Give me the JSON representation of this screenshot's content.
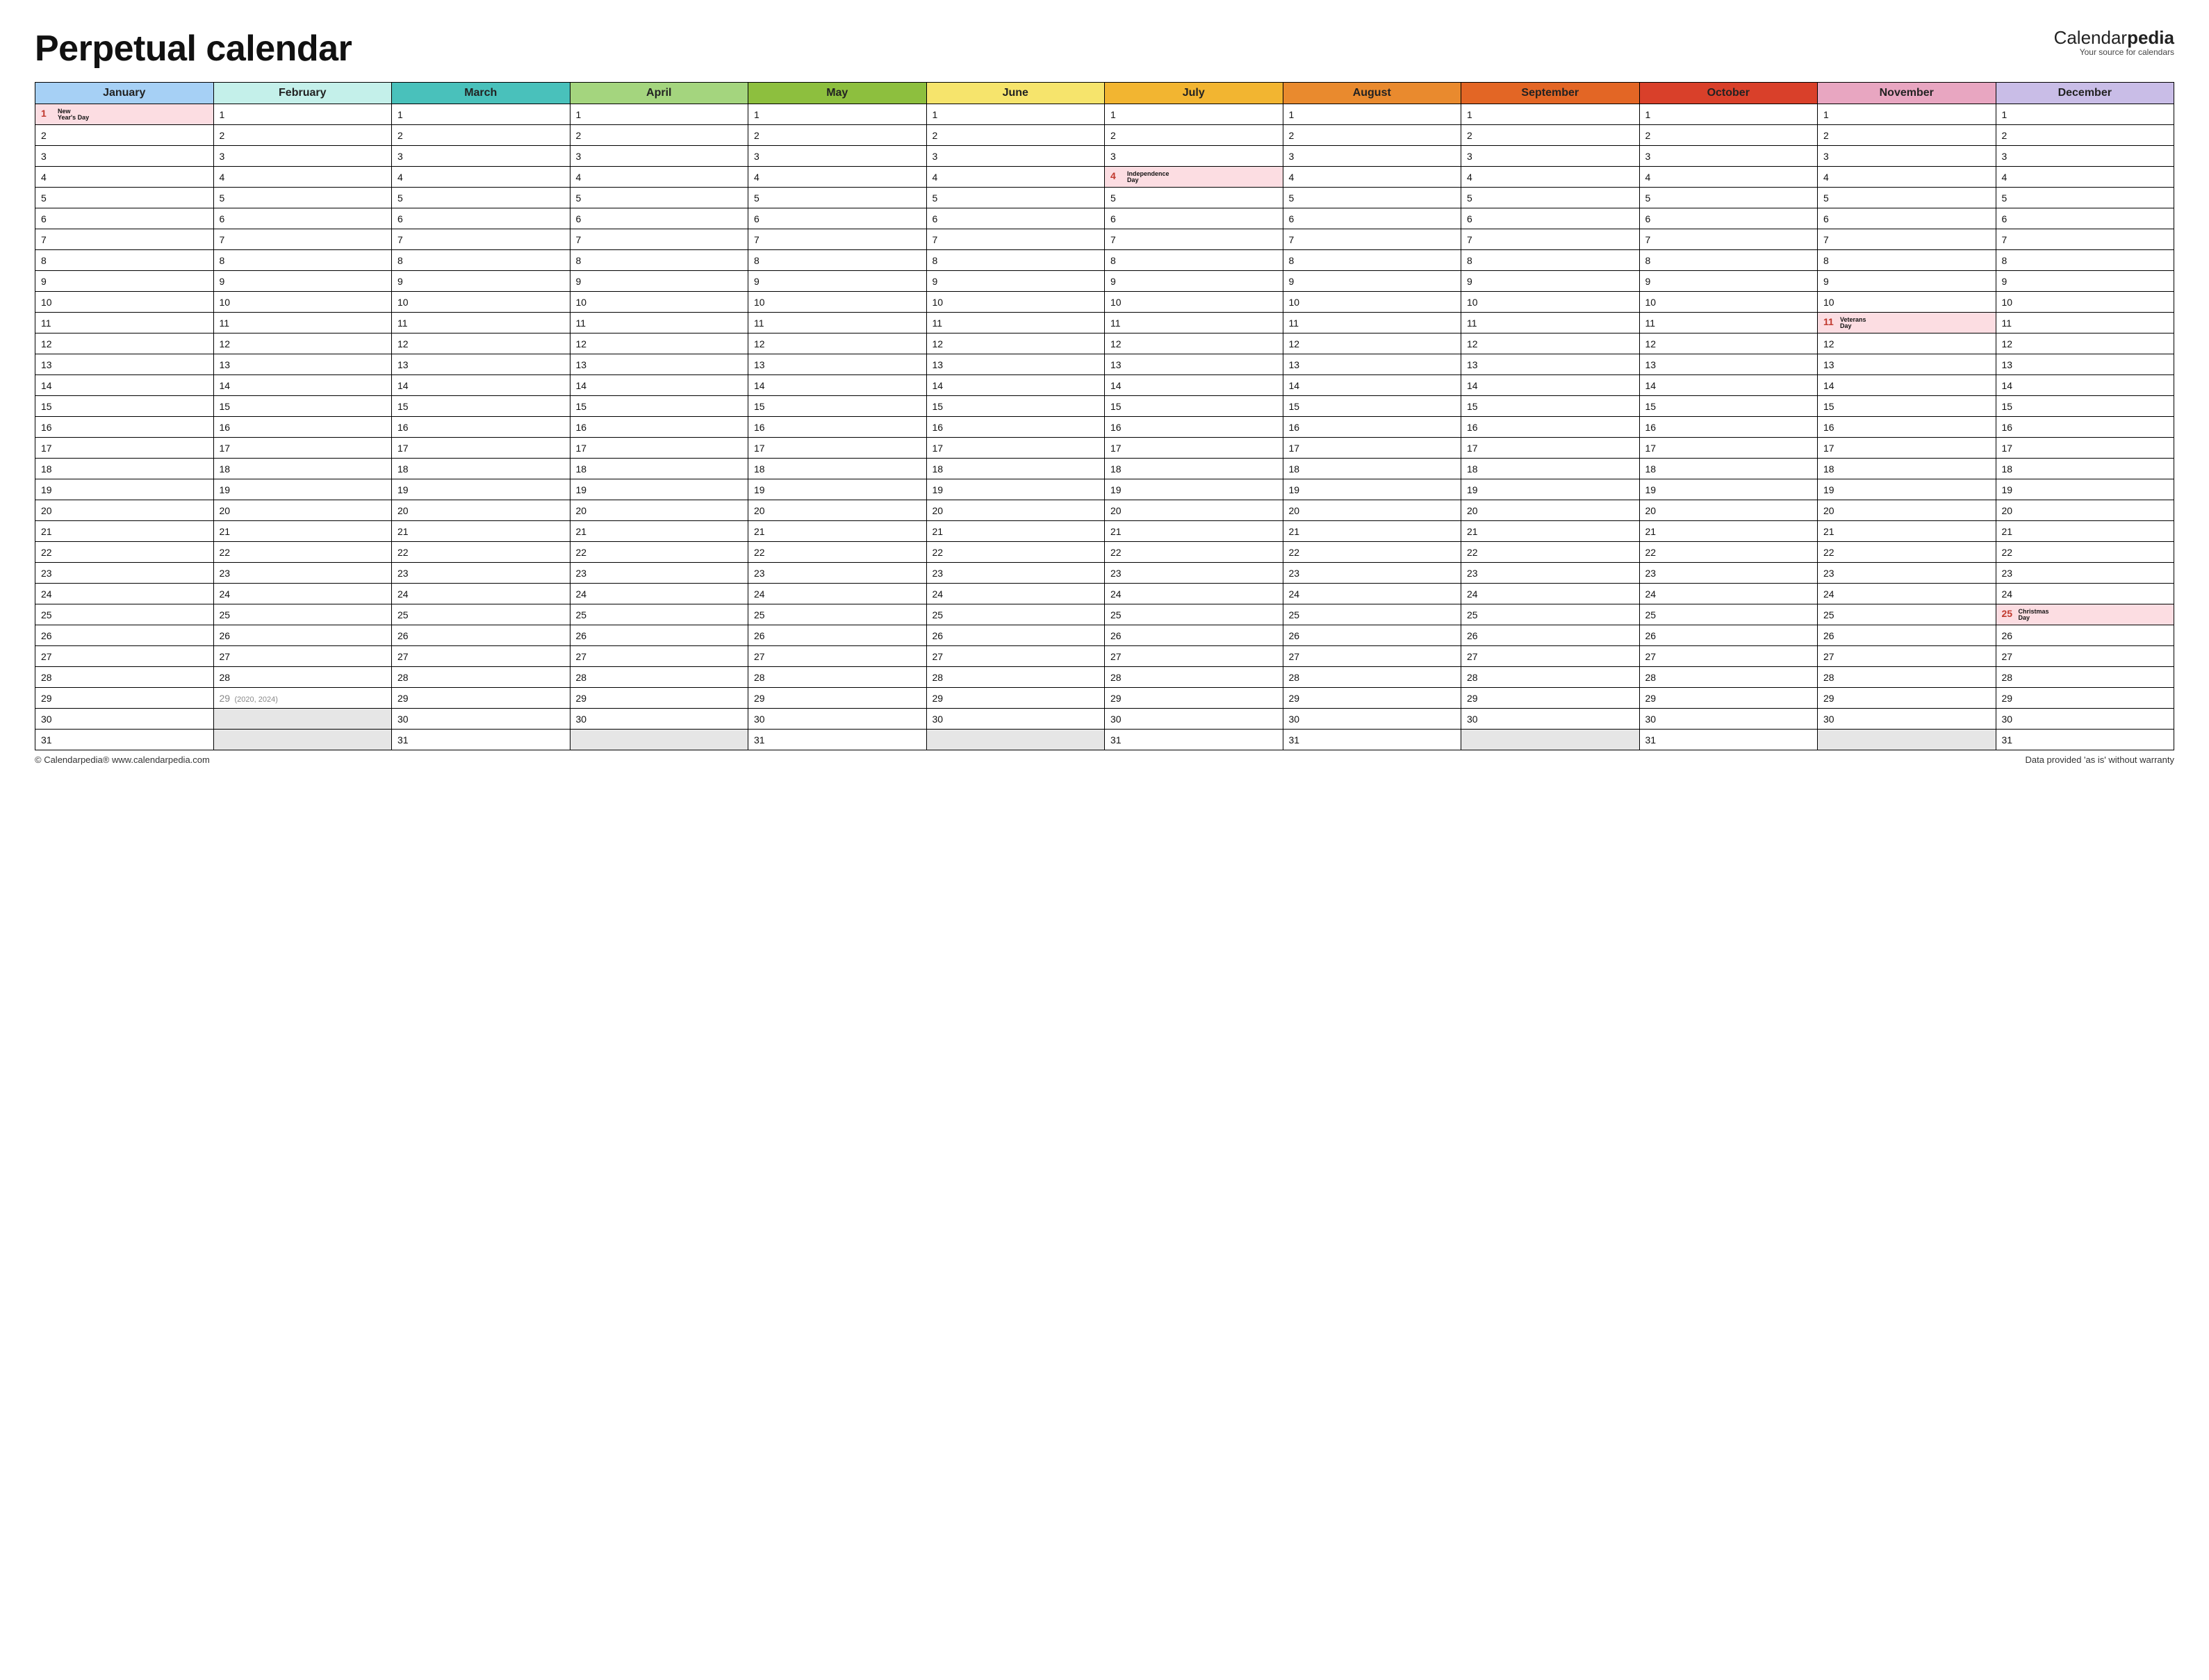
{
  "header": {
    "title": "Perpetual calendar",
    "brand_calendar": "Calendar",
    "brand_pedia": "pedia",
    "brand_tagline": "Your source for calendars"
  },
  "months": [
    {
      "name": "January",
      "color": "#a6d0f5",
      "days": 31
    },
    {
      "name": "February",
      "color": "#c4f0ea",
      "days": 29,
      "leap_day": 29,
      "leap_note": "(2020, 2024)"
    },
    {
      "name": "March",
      "color": "#49c1bb",
      "days": 31
    },
    {
      "name": "April",
      "color": "#a4d57e",
      "days": 30
    },
    {
      "name": "May",
      "color": "#8dbf3e",
      "days": 31
    },
    {
      "name": "June",
      "color": "#f6e46c",
      "days": 30
    },
    {
      "name": "July",
      "color": "#f2b531",
      "days": 31
    },
    {
      "name": "August",
      "color": "#e98a2e",
      "days": 31
    },
    {
      "name": "September",
      "color": "#e36625",
      "days": 30
    },
    {
      "name": "October",
      "color": "#d9402a",
      "days": 31
    },
    {
      "name": "November",
      "color": "#e8a6c1",
      "days": 30
    },
    {
      "name": "December",
      "color": "#c9bde7",
      "days": 31
    }
  ],
  "holidays": {
    "January-1": "New Year's Day",
    "July-4": "Independence Day",
    "November-11": "Veterans Day",
    "December-25": "Christmas Day"
  },
  "max_rows": 31,
  "footer": {
    "left": "© Calendarpedia®   www.calendarpedia.com",
    "right": "Data provided 'as is' without warranty"
  }
}
